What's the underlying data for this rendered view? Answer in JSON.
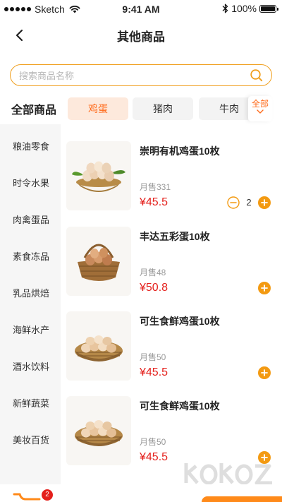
{
  "status_bar": {
    "carrier": "Sketch",
    "time": "9:41 AM",
    "battery": "100%"
  },
  "nav": {
    "title": "其他商品"
  },
  "search": {
    "placeholder": "搜索商品名称",
    "value": ""
  },
  "section_title": "全部商品",
  "category_tabs": [
    {
      "label": "鸡蛋",
      "active": true
    },
    {
      "label": "猪肉",
      "active": false
    },
    {
      "label": "牛肉",
      "active": false
    }
  ],
  "all_toggle_label": "全部",
  "sidebar": {
    "items": [
      {
        "label": "粮油零食"
      },
      {
        "label": "时令水果"
      },
      {
        "label": "肉禽蛋品"
      },
      {
        "label": "素食冻品"
      },
      {
        "label": "乳品烘焙"
      },
      {
        "label": "海鲜水产"
      },
      {
        "label": "酒水饮料"
      },
      {
        "label": "新鲜蔬菜"
      },
      {
        "label": "美妆百货"
      }
    ]
  },
  "products": [
    {
      "name": "崇明有机鸡蛋10枚",
      "sold": "月售331",
      "price": "¥45.5",
      "quantity": "2"
    },
    {
      "name": "丰达五彩蛋10枚",
      "sold": "月售48",
      "price": "¥50.8"
    },
    {
      "name": "可生食鲜鸡蛋10枚",
      "sold": "月售50",
      "price": "¥45.5"
    },
    {
      "name": "可生食鲜鸡蛋10枚",
      "sold": "月售50",
      "price": "¥45.5"
    }
  ],
  "cart": {
    "badge_count": "2"
  },
  "colors": {
    "accent": "#ff6a1a",
    "plus_button": "#f39a12",
    "price": "#e4201c",
    "search_border": "#f0a020"
  },
  "icons": [
    "back-arrow-icon",
    "wifi-icon",
    "bluetooth-icon",
    "battery-icon",
    "search-icon",
    "chevron-down-icon",
    "minus-circle-icon",
    "plus-circle-icon",
    "cart-icon"
  ],
  "watermark": "k0k0z.com"
}
